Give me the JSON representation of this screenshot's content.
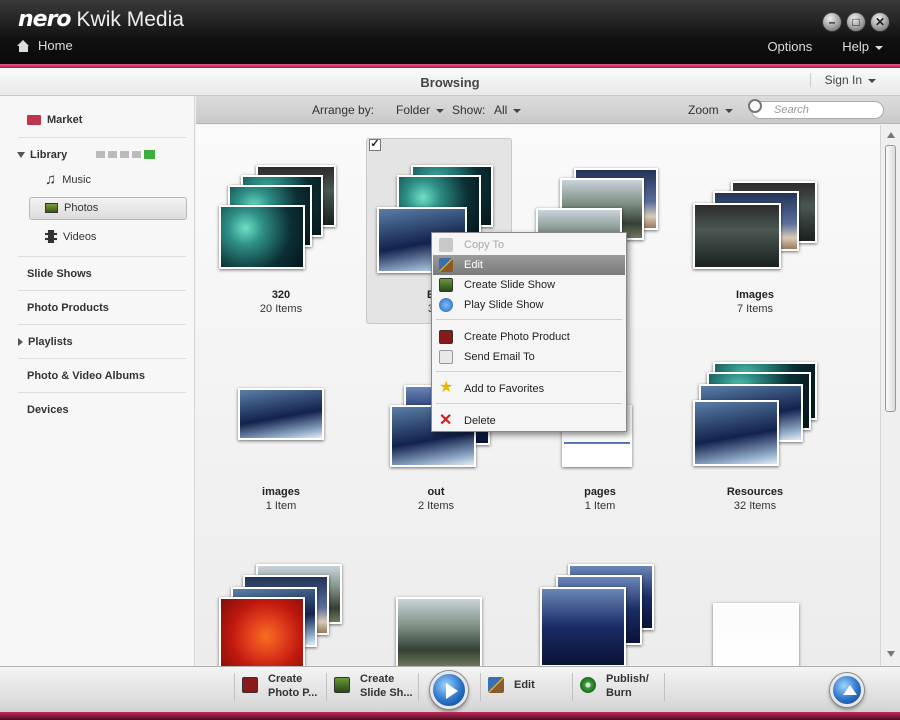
{
  "app": {
    "brand": "nero",
    "title": "Kwik Media",
    "home_label": "Home",
    "options_label": "Options",
    "help_label": "Help"
  },
  "header": {
    "browsing_title": "Browsing",
    "sign_in_label": "Sign In"
  },
  "sidebar": {
    "market": "Market",
    "library": "Library",
    "music": "Music",
    "photos": "Photos",
    "videos": "Videos",
    "slide_shows": "Slide Shows",
    "photo_products": "Photo Products",
    "playlists": "Playlists",
    "albums": "Photo & Video Albums",
    "devices": "Devices"
  },
  "toolbar": {
    "arrange_label": "Arrange by:",
    "arrange_value": "Folder",
    "show_label": "Show:",
    "show_value": "All",
    "zoom_label": "Zoom",
    "search_placeholder": "Search"
  },
  "folders": [
    {
      "name": "320",
      "count": "20 Items"
    },
    {
      "name": "Ba",
      "count": "32"
    },
    {
      "name": "",
      "count": ""
    },
    {
      "name": "Images",
      "count": "7 Items"
    },
    {
      "name": "images",
      "count": "1 Item"
    },
    {
      "name": "out",
      "count": "2 Items"
    },
    {
      "name": "pages",
      "count": "1 Item"
    },
    {
      "name": "Resources",
      "count": "32 Items"
    }
  ],
  "context_menu": {
    "copy_to": "Copy To",
    "edit": "Edit",
    "create_slide_show": "Create Slide Show",
    "play_slide_show": "Play Slide Show",
    "create_photo_product": "Create Photo Product",
    "send_email_to": "Send Email To",
    "add_to_favorites": "Add to Favorites",
    "delete": "Delete"
  },
  "bottom_bar": {
    "create_photo_1": "Create",
    "create_photo_2": "Photo P...",
    "create_slide_1": "Create",
    "create_slide_2": "Slide Sh...",
    "edit": "Edit",
    "publish_1": "Publish/",
    "publish_2": "Burn"
  },
  "colors": {
    "accent_pink": "#c41e5a",
    "highlight_green": "#3fae3f",
    "play_blue": "#2a73c9"
  }
}
